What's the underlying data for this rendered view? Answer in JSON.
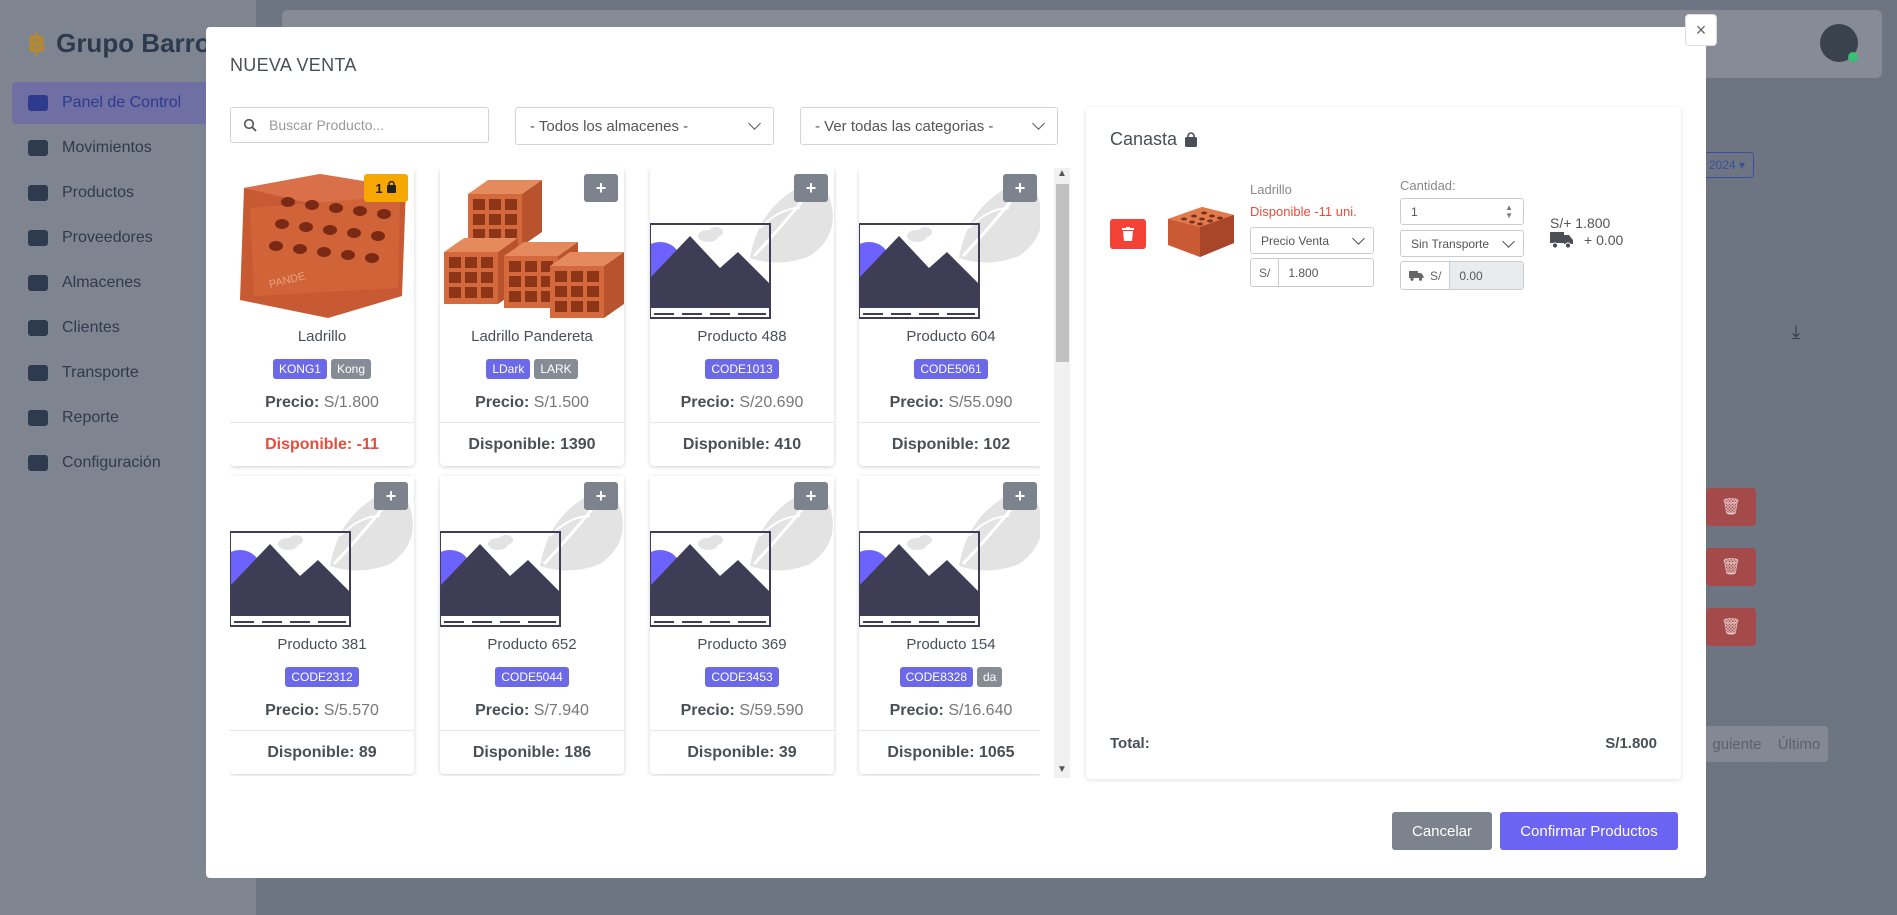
{
  "background": {
    "brand": "Grupo Barro",
    "nav": [
      {
        "label": "Panel de Control",
        "icon": "dashboard-icon",
        "active": true
      },
      {
        "label": "Movimientos",
        "icon": "list-icon"
      },
      {
        "label": "Productos",
        "icon": "box-icon"
      },
      {
        "label": "Proveedores",
        "icon": "users-icon"
      },
      {
        "label": "Almacenes",
        "icon": "warehouse-icon"
      },
      {
        "label": "Clientes",
        "icon": "user-icon"
      },
      {
        "label": "Transporte",
        "icon": "truck-icon"
      },
      {
        "label": "Reporte",
        "icon": "chart-icon"
      },
      {
        "label": "Configuración",
        "icon": "menu-icon"
      }
    ],
    "year_button": "2024",
    "pagination": [
      "guiente",
      "Último"
    ]
  },
  "modal": {
    "title": "NUEVA VENTA",
    "close": "×",
    "search": {
      "placeholder": "Buscar Producto..."
    },
    "warehouse_filter": "- Todos los almacenes -",
    "category_filter": "- Ver todas las categorias -",
    "products": [
      {
        "name": "Ladrillo",
        "tags": [
          {
            "t": "KONG1",
            "k": "primary"
          },
          {
            "t": "Kong",
            "k": "secondary"
          }
        ],
        "price_label": "Precio:",
        "price": "S/1.800",
        "stock": "Disponible: -11",
        "badge": "1",
        "image": "brick"
      },
      {
        "name": "Ladrillo Pandereta",
        "tags": [
          {
            "t": "LDark",
            "k": "primary"
          },
          {
            "t": "LARK",
            "k": "secondary"
          }
        ],
        "price_label": "Precio:",
        "price": "S/1.500",
        "stock": "Disponible: 1390",
        "image": "bricks"
      },
      {
        "name": "Producto 488",
        "tags": [
          {
            "t": "CODE1013",
            "k": "primary"
          }
        ],
        "price_label": "Precio:",
        "price": "S/20.690",
        "stock": "Disponible: 410",
        "image": "placeholder"
      },
      {
        "name": "Producto 604",
        "tags": [
          {
            "t": "CODE5061",
            "k": "primary"
          }
        ],
        "price_label": "Precio:",
        "price": "S/55.090",
        "stock": "Disponible: 102",
        "image": "placeholder"
      },
      {
        "name": "Producto 381",
        "tags": [
          {
            "t": "CODE2312",
            "k": "primary"
          }
        ],
        "price_label": "Precio:",
        "price": "S/5.570",
        "stock": "Disponible: 89",
        "image": "placeholder"
      },
      {
        "name": "Producto 652",
        "tags": [
          {
            "t": "CODE5044",
            "k": "primary"
          }
        ],
        "price_label": "Precio:",
        "price": "S/7.940",
        "stock": "Disponible: 186",
        "image": "placeholder"
      },
      {
        "name": "Producto 369",
        "tags": [
          {
            "t": "CODE3453",
            "k": "primary"
          }
        ],
        "price_label": "Precio:",
        "price": "S/59.590",
        "stock": "Disponible: 39",
        "image": "placeholder"
      },
      {
        "name": "Producto 154",
        "tags": [
          {
            "t": "CODE8328",
            "k": "primary"
          },
          {
            "t": "da",
            "k": "secondary"
          }
        ],
        "price_label": "Precio:",
        "price": "S/16.640",
        "stock": "Disponible: 1065",
        "image": "placeholder"
      }
    ],
    "basket": {
      "title": "Canasta",
      "item": {
        "name": "Ladrillo",
        "availability": "Disponible -11 uni.",
        "price_type": "Precio Venta",
        "currency": "S/",
        "price": "1.800",
        "quantity_label": "Cantidad:",
        "quantity": "1",
        "transport": "Sin Transporte",
        "transport_cost": "0.00",
        "subtotal": "S/+ 1.800",
        "transport_sum": "+ 0.00"
      },
      "total_label": "Total:",
      "total": "S/1.800"
    },
    "cancel": "Cancelar",
    "confirm": "Confirmar Productos"
  }
}
